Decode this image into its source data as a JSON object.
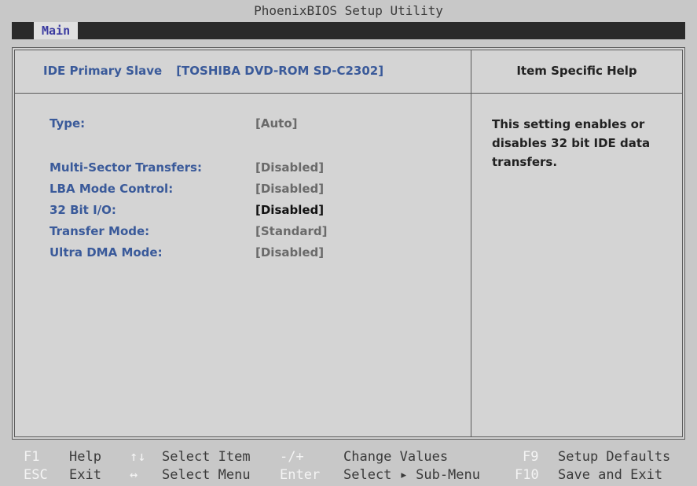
{
  "app": {
    "title": "PhoenixBIOS Setup Utility"
  },
  "menu": {
    "active_tab": "Main"
  },
  "header": {
    "item": "IDE Primary Slave",
    "device": "[TOSHIBA DVD-ROM SD-C2302]",
    "help_title": "Item Specific Help"
  },
  "settings": [
    {
      "label": "Type:",
      "value": "[Auto]"
    },
    {
      "label": "Multi-Sector Transfers:",
      "value": "[Disabled]"
    },
    {
      "label": "LBA Mode Control:",
      "value": "[Disabled]"
    },
    {
      "label": "32 Bit I/O:",
      "value": "[Disabled]"
    },
    {
      "label": "Transfer Mode:",
      "value": "[Standard]"
    },
    {
      "label": "Ultra DMA Mode:",
      "value": "[Disabled]"
    }
  ],
  "help": {
    "text": "This setting enables or disables 32 bit IDE data transfers."
  },
  "footer": {
    "row1": [
      {
        "key": "F1",
        "text": "Help"
      },
      {
        "key": "↑↓",
        "text": "Select Item"
      },
      {
        "key": "-/+",
        "text": "Change Values"
      },
      {
        "key": "F9",
        "text": "Setup Defaults"
      }
    ],
    "row2": [
      {
        "key": "ESC",
        "text": "Exit"
      },
      {
        "key": "↔",
        "text": "Select Menu"
      },
      {
        "key": "Enter",
        "text": "Select ▸ Sub-Menu"
      },
      {
        "key": "F10",
        "text": "Save and Exit"
      }
    ]
  },
  "colors": {
    "background": "#c8c8c8",
    "label": "#3a5a9a",
    "value": "#6a6a6a",
    "active_value": "#111111",
    "footer_key": "#f4f4f4"
  }
}
